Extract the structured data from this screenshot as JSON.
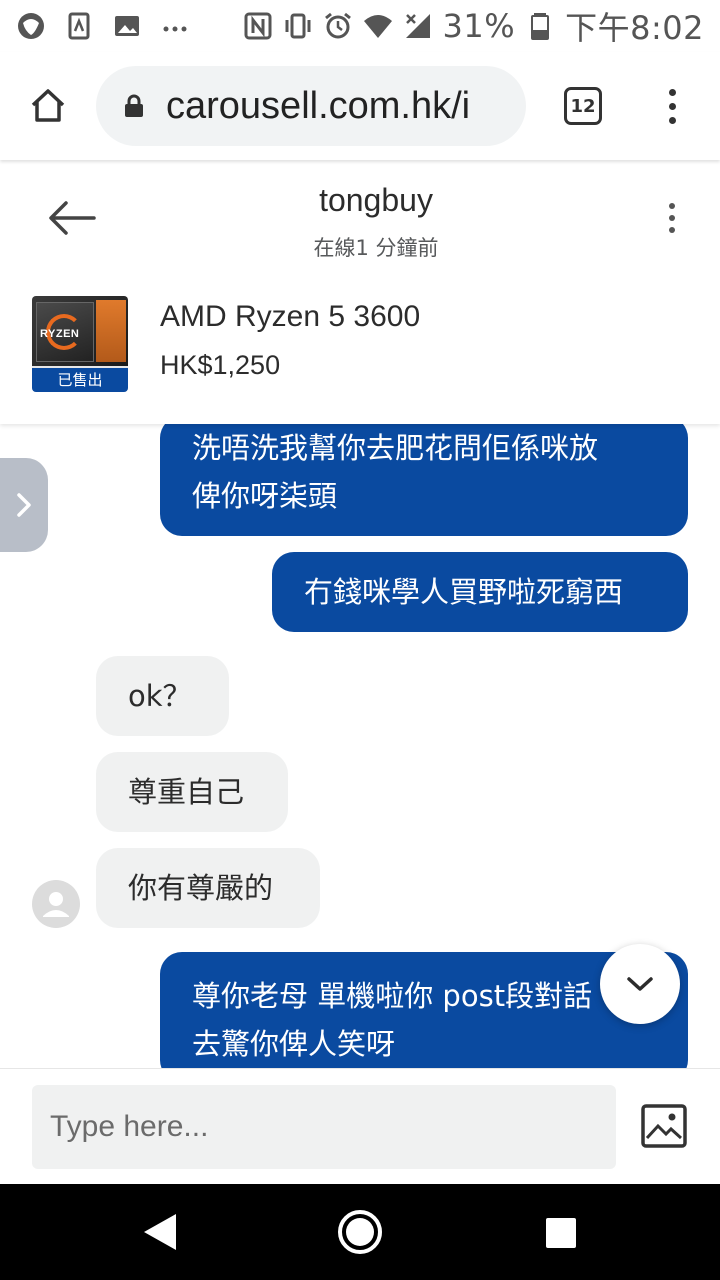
{
  "status_bar": {
    "battery": "31%",
    "time": "下午8:02"
  },
  "browser": {
    "url": "carousell.com.hk/i",
    "tab_count": "12"
  },
  "chat": {
    "name": "tongbuy",
    "status": "在線1 分鐘前",
    "product": {
      "title": "AMD Ryzen 5 3600",
      "price": "HK$1,250",
      "badge": "已售出",
      "brand_text": "RYZEN"
    }
  },
  "messages": [
    {
      "dir": "out",
      "lines": [
        "洗唔洗我幫你去肥花問佢係咪放",
        "俾你呀柒頭"
      ]
    },
    {
      "dir": "out",
      "lines": [
        "冇錢咪學人買野啦死窮西"
      ]
    },
    {
      "dir": "in",
      "lines": [
        "ok？"
      ]
    },
    {
      "dir": "in",
      "lines": [
        "尊重自己"
      ]
    },
    {
      "dir": "in",
      "lines": [
        "你有尊嚴的"
      ]
    },
    {
      "dir": "out",
      "lines": [
        "尊你老母 單機啦你 post段對話",
        "去驚你俾人笑呀"
      ]
    }
  ],
  "input": {
    "placeholder": "Type here..."
  },
  "colors": {
    "outgoing_bubble": "#0a4aa0",
    "incoming_bubble": "#f0f1f1"
  }
}
